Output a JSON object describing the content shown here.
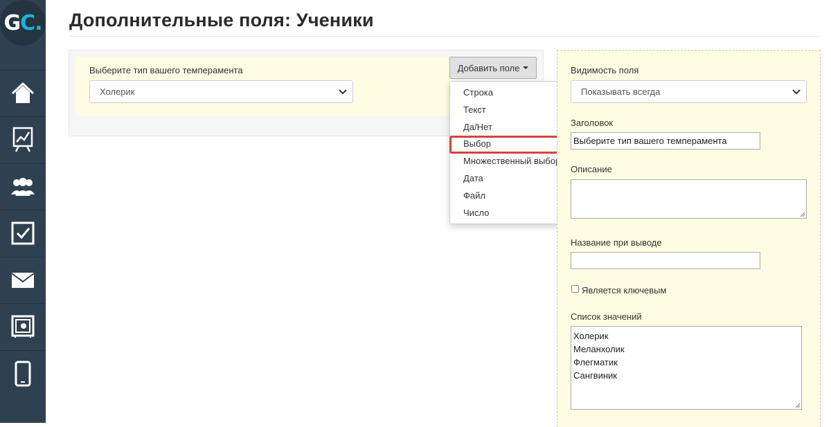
{
  "logo": {
    "g": "G",
    "c": "C",
    "dot": "."
  },
  "sidebar": {
    "items": [
      {
        "icon": "home-icon"
      },
      {
        "icon": "chart-board-icon"
      },
      {
        "icon": "users-icon"
      },
      {
        "icon": "checkbox-icon"
      },
      {
        "icon": "mail-icon"
      },
      {
        "icon": "safe-icon"
      },
      {
        "icon": "mobile-icon"
      }
    ],
    "colors": {
      "bg": "#2f4050",
      "icon": "#ffffff",
      "logo_accent": "#1bb3d6"
    }
  },
  "page": {
    "title": "Дополнительные поля: Ученики"
  },
  "preview": {
    "field_label": "Выберите тип вашего темперамента",
    "select_value": "Холерик"
  },
  "add_field": {
    "button_label": "Добавить поле",
    "menu": [
      "Строка",
      "Текст",
      "Да/Нет",
      "Выбор",
      "Множественный выбор",
      "Дата",
      "Файл",
      "Число"
    ],
    "highlighted": "Выбор",
    "highlight_color": "#d9413a"
  },
  "settings": {
    "visibility_label": "Видимость поля",
    "visibility_value": "Показывать всегда",
    "title_label": "Заголовок",
    "title_value": "Выберите тип вашего темперамента",
    "description_label": "Описание",
    "display_name_label": "Название при выводе",
    "display_name_value": "",
    "is_key_label": "Является ключевым",
    "values_label": "Список значений",
    "values": [
      "Холерик",
      "Меланхолик",
      "Флегматик",
      "Сангвиник"
    ]
  }
}
